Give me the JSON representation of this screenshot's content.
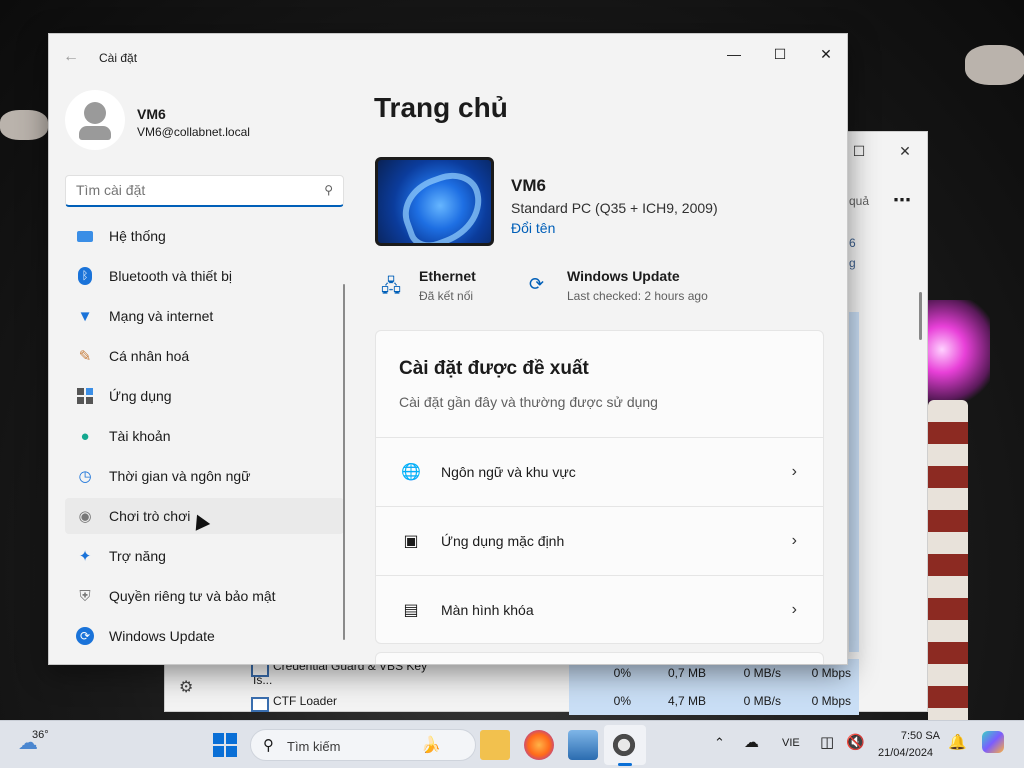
{
  "settings": {
    "app_title": "Cài đặt",
    "profile": {
      "name": "VM6",
      "email": "VM6@collabnet.local"
    },
    "search_placeholder": "Tìm cài đặt",
    "nav": [
      {
        "label": "Hệ thống",
        "icon": "system-icon"
      },
      {
        "label": "Bluetooth và thiết bị",
        "icon": "bluetooth-icon"
      },
      {
        "label": "Mạng và internet",
        "icon": "wifi-icon"
      },
      {
        "label": "Cá nhân hoá",
        "icon": "brush-icon"
      },
      {
        "label": "Ứng dụng",
        "icon": "apps-icon"
      },
      {
        "label": "Tài khoản",
        "icon": "account-icon"
      },
      {
        "label": "Thời gian và ngôn ngữ",
        "icon": "globe-clock-icon"
      },
      {
        "label": "Chơi trò chơi",
        "icon": "gamepad-icon"
      },
      {
        "label": "Trợ năng",
        "icon": "accessibility-icon"
      },
      {
        "label": "Quyền riêng tư và bảo mật",
        "icon": "shield-icon"
      },
      {
        "label": "Windows Update",
        "icon": "update-icon"
      }
    ],
    "page_title": "Trang chủ",
    "device": {
      "name": "VM6",
      "model": "Standard PC (Q35 + ICH9, 2009)",
      "rename": "Đổi tên"
    },
    "status": {
      "ethernet": {
        "title": "Ethernet",
        "sub": "Đã kết nối"
      },
      "update": {
        "title": "Windows Update",
        "sub": "Last checked: 2 hours ago"
      }
    },
    "recommended": {
      "title": "Cài đặt được đề xuất",
      "subtitle": "Cài đặt gần đây và thường được sử dụng",
      "items": [
        {
          "label": "Ngôn ngữ và khu vực"
        },
        {
          "label": "Ứng dụng mặc định"
        },
        {
          "label": "Màn hình khóa"
        }
      ]
    }
  },
  "taskmgr": {
    "rows": [
      {
        "name": "Credential Guard & VBS Key Is...",
        "cpu": "0%",
        "memory": "0,7 MB",
        "disk": "0 MB/s",
        "network": "0 Mbps"
      },
      {
        "name": "CTF Loader",
        "cpu": "0%",
        "memory": "4,7 MB",
        "disk": "0 MB/s",
        "network": "0 Mbps"
      }
    ],
    "side_text": "quả",
    "side_digit": "6",
    "side_g": "g",
    "side_s": "s"
  },
  "taskbar": {
    "temperature": "36°",
    "search_label": "Tìm kiếm",
    "language": "VIE",
    "time": "7:50 SA",
    "date": "21/04/2024"
  }
}
